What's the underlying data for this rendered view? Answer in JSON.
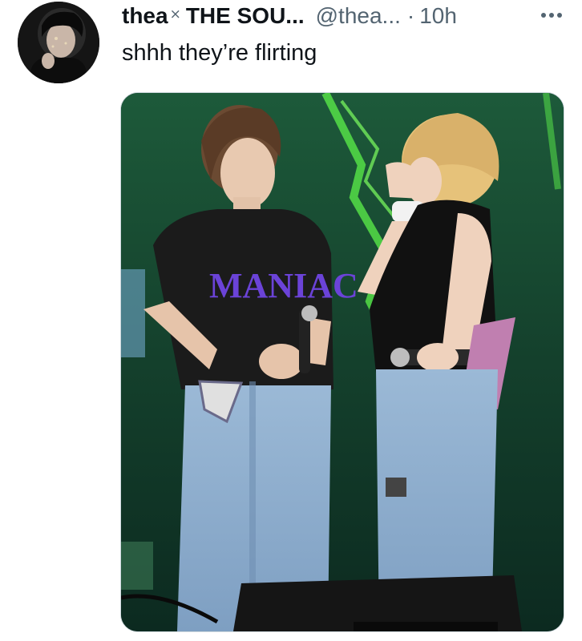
{
  "tweet": {
    "display_name": "thea",
    "name_mark": "⨯",
    "name_rest": "THE SOU...",
    "handle": "@thea...",
    "separator": "·",
    "time": "10h",
    "text": "shhh they’re flirting"
  },
  "icons": {
    "more": "more-horizontal-icon",
    "avatar": "avatar-image"
  },
  "media": {
    "shirt_print": "MANIAC"
  },
  "colors": {
    "text_primary": "#0f1419",
    "text_secondary": "#536471",
    "border": "#cfd9de",
    "stage_green": "#2f8a4a",
    "laser_green": "#5cf24a"
  }
}
